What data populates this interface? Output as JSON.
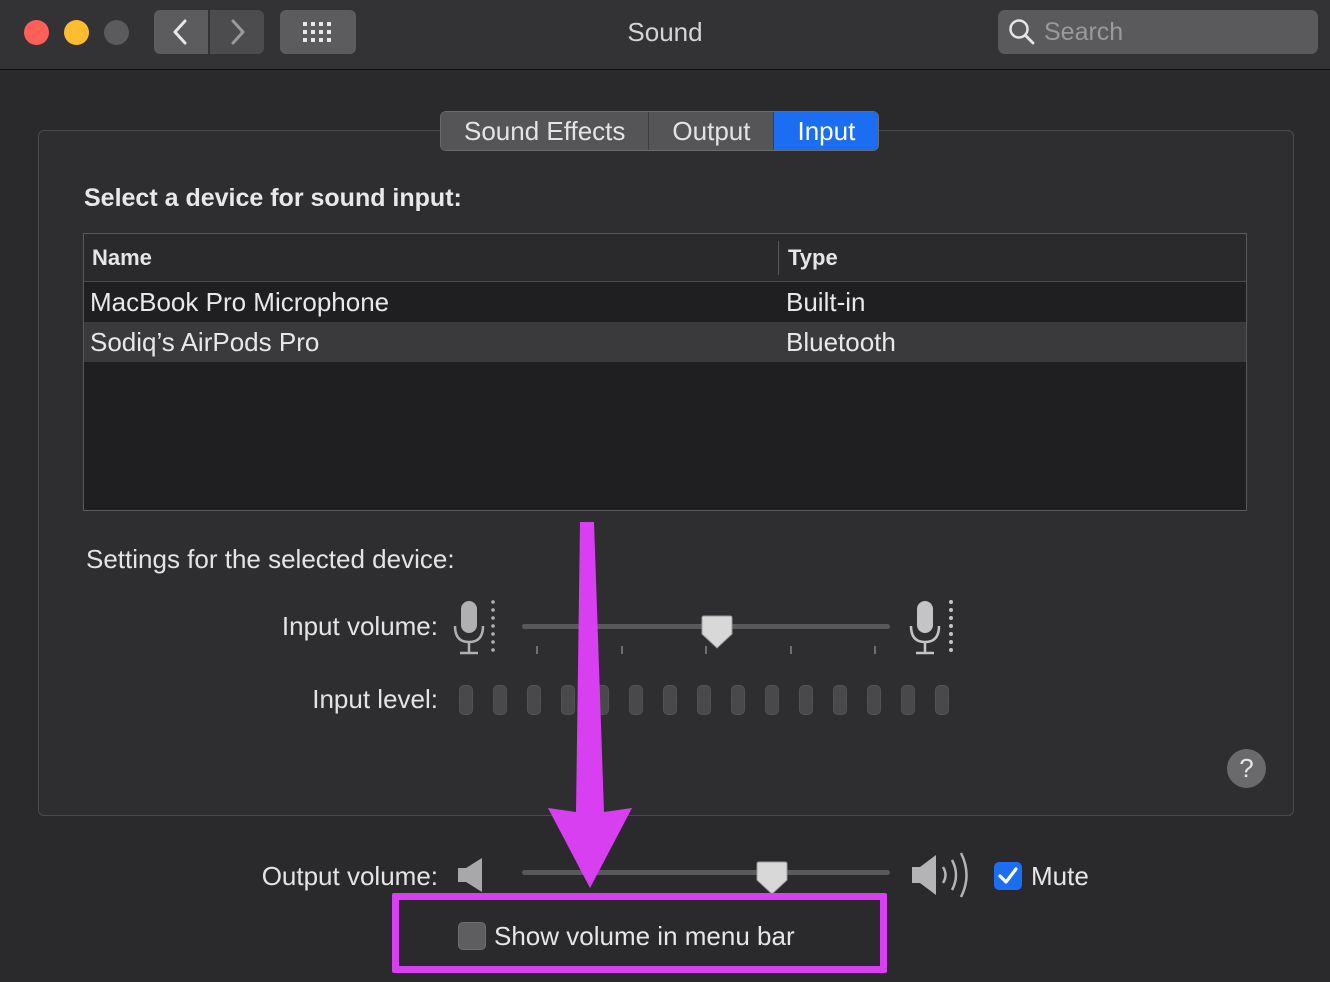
{
  "window": {
    "title": "Sound",
    "search_placeholder": "Search"
  },
  "tabs": [
    {
      "label": "Sound Effects",
      "active": false
    },
    {
      "label": "Output",
      "active": false
    },
    {
      "label": "Input",
      "active": true
    }
  ],
  "input_panel": {
    "heading": "Select a device for sound input:",
    "columns": [
      "Name",
      "Type"
    ],
    "devices": [
      {
        "name": "MacBook Pro Microphone",
        "type": "Built-in",
        "selected": false
      },
      {
        "name": "Sodiq’s AirPods Pro",
        "type": "Bluetooth",
        "selected": true
      }
    ],
    "settings_heading": "Settings for the selected device:",
    "input_volume_label": "Input volume:",
    "input_volume_fraction": 0.53,
    "input_level_label": "Input level:",
    "input_level_segments": 15,
    "help_label": "?"
  },
  "output": {
    "output_volume_label": "Output volume:",
    "output_volume_fraction": 0.68,
    "mute_label": "Mute",
    "mute_checked": true,
    "show_volume_label": "Show volume in menu bar",
    "show_volume_checked": false
  },
  "colors": {
    "accent": "#1b6df2",
    "annotation": "#d83ff0"
  }
}
